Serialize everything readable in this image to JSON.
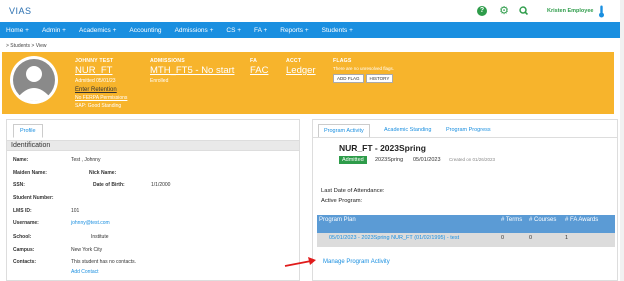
{
  "app": {
    "logo": "VIAS",
    "user_name": "Kristen Employee"
  },
  "colors": {
    "nav": "#1a8fe0",
    "banner": "#f7b42c",
    "badge": "#2e9c4a",
    "table_header": "#5b9bd5"
  },
  "icons": {
    "help": "help-circle-icon",
    "settings": "gear-icon",
    "search": "search-icon",
    "thermometer": "thermometer-icon"
  },
  "nav": [
    "Home +",
    "Admin +",
    "Academics +",
    "Accounting",
    "Admissions +",
    "CS +",
    "FA +",
    "Reports +",
    "Students +"
  ],
  "breadcrumb": "> Students  > View",
  "banner": {
    "name_label": "JOHNNY TEST",
    "program_code": "NUR_FT",
    "admitted": "Admitted 05/01/23",
    "enter_retention": "Enter Retention",
    "ferpa": "No FERPA Permissions",
    "sap": "SAP: Good Standing",
    "admissions_label": "ADMISSIONS",
    "admissions_value": "MTH_FT5 - No start",
    "admissions_status": "Enrolled",
    "fa_label": "FA",
    "fa_value": "FAC",
    "acct_label": "ACCT",
    "acct_value": "Ledger",
    "flags_label": "FLAGS",
    "flags_text": "There are no unresolved flags.",
    "add_flag": "ADD FLAG",
    "history": "HISTORY"
  },
  "profile": {
    "tab": "Profile",
    "section": "Identification",
    "fields": {
      "name_label": "Name:",
      "name_value": "Test , Johnny",
      "maiden_label": "Maiden Name:",
      "nick_label": "Nick Name:",
      "ssn_label": "SSN:",
      "dob_label": "Date of Birth:",
      "dob_value": "1/1/2000",
      "student_number_label": "Student Number:",
      "lms_label": "LMS ID:",
      "lms_value": "101",
      "username_label": "Username:",
      "username_value": "johnny@test.com",
      "school_label": "School:",
      "school_value": "Institute",
      "campus_label": "Campus:",
      "campus_value": "New York City",
      "contacts_label": "Contacts:",
      "contacts_value": "This student has no contacts.",
      "add_contact": "Add Contact"
    }
  },
  "activity": {
    "tabs": [
      "Program Activity",
      "Academic Standing",
      "Program Progress"
    ],
    "program_title": "NUR_FT - 2023Spring",
    "badge": "Admitted",
    "term": "2023Spring",
    "start_date": "05/01/2023",
    "created": "Created on 01/26/2023",
    "last_attendance": "Last Date of Attendance:",
    "active_program": "Active Program:",
    "table": {
      "headers": [
        "Program Plan",
        "# Terms",
        "# Courses",
        "# FA Awards"
      ],
      "row": [
        "05/01/2023 - 2023Spring NUR_FT (01/02/1995) - test",
        "0",
        "0",
        "1"
      ]
    },
    "manage_link": "Manage Program Activity"
  }
}
